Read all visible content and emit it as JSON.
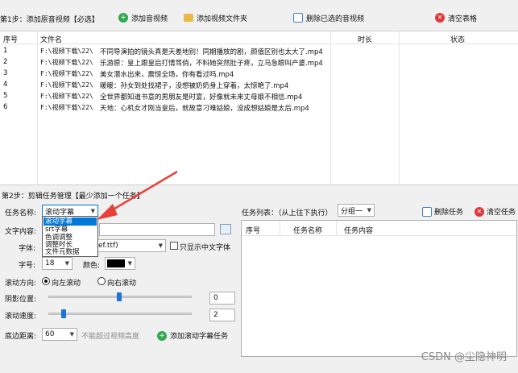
{
  "step1": {
    "label": "第1步：添加原音视频【必选】",
    "add_video": "添加音视频",
    "add_folder": "添加视频文件夹",
    "delete_selected": "删除已选的音视频",
    "clear_table": "清空表格"
  },
  "table": {
    "headers": [
      "序号",
      "文件名",
      "时长",
      "状态"
    ],
    "rows": [
      {
        "no": "1",
        "path": "F:\\视频下载\\22\\",
        "title": "不同导演拍的镜头真是天差地别！同期播放的剧，颜值区别也太大了.mp4"
      },
      {
        "no": "2",
        "path": "F:\\视频下载\\22\\",
        "title": "乐游原：皇上跟皇后打情骂俏，不料她突然肚子疼，立马急眼叫产婆.mp4"
      },
      {
        "no": "3",
        "path": "F:\\视频下载\\22\\",
        "title": "美女潜水出来，震惊全场，你有看过吗.mp4"
      },
      {
        "no": "4",
        "path": "F:\\视频下载\\22\\",
        "title": "暖暖：孙女到处找裙子，没想被奶奶身上穿着，太惊艳了.mp4"
      },
      {
        "no": "5",
        "path": "F:\\视频下载\\22\\",
        "title": "全世界都知道书意的男朋友是时宴，好像就未来丈母娘不相信.mp4"
      },
      {
        "no": "6",
        "path": "F:\\视频下载\\22\\",
        "title": "天地：心机女才刚当皇后，就故意刁难姑娘，没成想姑娘是太后.mp4"
      }
    ]
  },
  "step2": {
    "label": "第2步：剪辑任务管理【最少添加一个任务】",
    "task_name_label": "任务名称:",
    "task_name_value": "滚动字幕",
    "dropdown_options": [
      "滚动字幕",
      "srt字幕",
      "色调调整",
      "调整时长",
      "文件元数据"
    ],
    "text_content_label": "文字内容:",
    "font_label": "字体:",
    "font_value_visible": "ef.ttf)",
    "chinese_font_only": "只显示中文字体",
    "size_label": "字号:",
    "size_value": "18",
    "color_label": "颜色:",
    "color_value": "#000000",
    "scroll_dir_label": "滚动方向:",
    "scroll_left": "向左滚动",
    "scroll_right": "向右滚动",
    "shadow_label": "阴影位置:",
    "shadow_value": "0",
    "speed_label": "滚动速度:",
    "speed_value": "2",
    "bottom_label": "底边距离:",
    "bottom_value": "60",
    "bottom_hint": "不能超过视频高度",
    "add_task": "添加滚动字幕任务"
  },
  "tasks": {
    "label": "任务列表：（从上往下执行）",
    "group_value": "分组一",
    "delete_task": "删除任务",
    "clear_tasks": "清空任务",
    "headers": [
      "序号",
      "任务名称",
      "任务内容"
    ]
  },
  "watermark": "CSDN @尘隐神明",
  "colors": {
    "selection": "#0078d7",
    "arrow": "#e8413a",
    "thumb": "#1e73d4",
    "green_icon": "#2fa84f",
    "red_icon": "#e0393b"
  }
}
